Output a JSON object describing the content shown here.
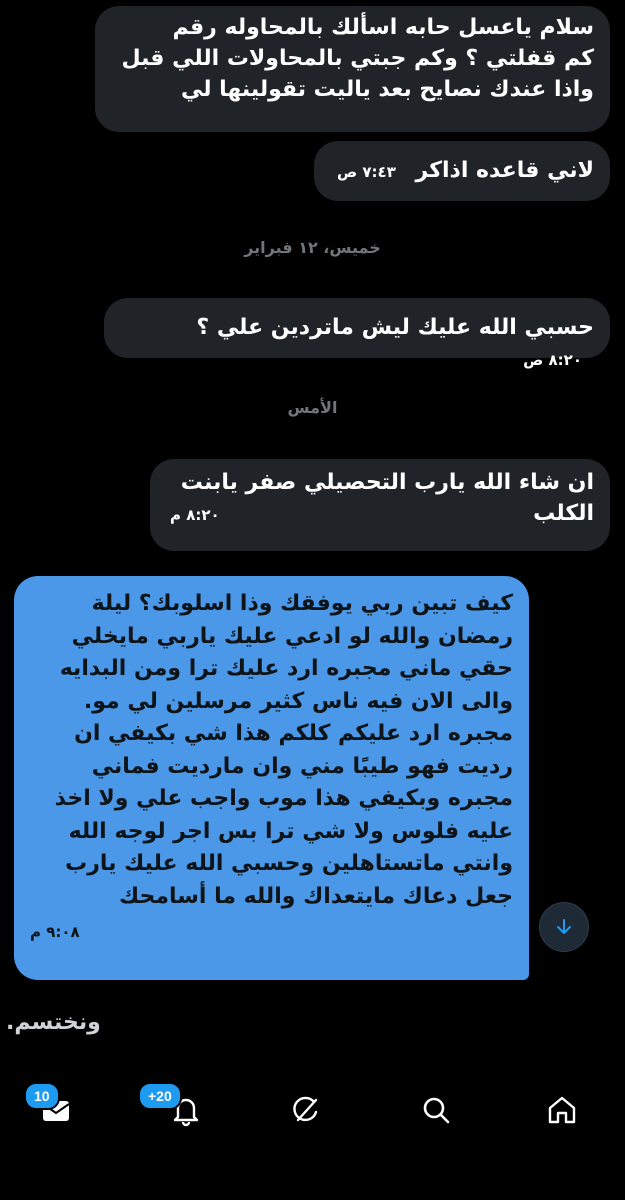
{
  "messages": [
    {
      "text_lines": [
        "سلام ياعسل حابه اسألك بالمحاوله رقم",
        "كم قفلتي ؟ وكم جبتي بالمحاولات اللي قبل",
        "واذا عندك نصايح بعد ياليت تقولينها لي"
      ]
    },
    {
      "text": "لاني قاعده اذاكر",
      "time": "٧:٤٣ ص"
    },
    {
      "text": "حسبي الله عليك ليش ماتردين علي ؟",
      "time": "٨:٢٠ ص"
    },
    {
      "text_lines": [
        "ان شاء الله يارب التحصيلي صفر يابنت",
        "الكلب"
      ],
      "time": "٨:٢٠ م"
    },
    {
      "text_lines": [
        "كيف تبين ربي يوفقك وذا اسلوبك؟ ليلة",
        "رمضان والله لو ادعي عليك ياربي مايخلي",
        "حقي ماني مجبره ارد عليك ترا ومن البدايه",
        "والى الان فيه ناس كثير مرسلين لي مو.",
        "مجبره ارد عليكم كلكم هذا شي بكيفي ان",
        "رديت فهو طيبًا مني وان مارديت فماني",
        "مجبره وبكيفي هذا موب واجب علي ولا اخذ",
        "عليه فلوس ولا شي ترا بس اجر لوجه الله",
        "وانتي ماتستاهلين وحسبي الله عليك يارب",
        "جعل دعاك مايتعداك والله ما أسامحك"
      ],
      "time": "٩:٠٨ م"
    }
  ],
  "date_separators": [
    "خميس، ١٢ فبراير",
    "الأمس"
  ],
  "typing_text": "ونختسم.",
  "nav": {
    "messages_badge": "10",
    "notifications_badge": "+20"
  },
  "colors": {
    "incoming": "#202327",
    "outgoing": "#4a98e7",
    "accent": "#1d9bf0"
  },
  "icons": [
    "arrow-down-icon",
    "mail-icon",
    "bell-icon",
    "grok-icon",
    "search-icon",
    "home-icon"
  ]
}
